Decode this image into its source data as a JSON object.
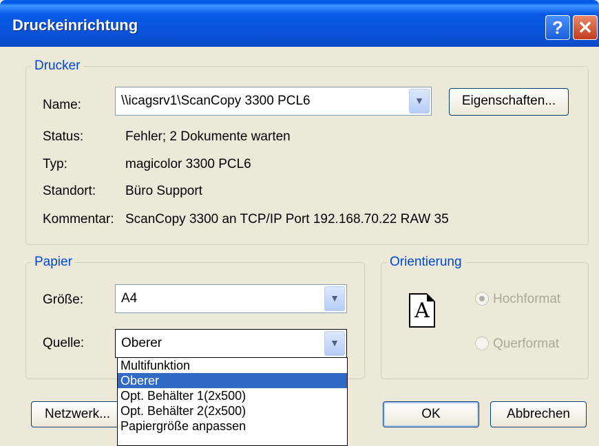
{
  "window": {
    "title": "Druckeinrichtung",
    "help_glyph": "?",
    "close_glyph": "✕"
  },
  "printer": {
    "group_label": "Drucker",
    "name_label": "Name:",
    "name_value": "\\\\icagsrv1\\ScanCopy 3300 PCL6",
    "properties_button": "Eigenschaften...",
    "status_label": "Status:",
    "status_value": "Fehler; 2 Dokumente warten",
    "type_label": "Typ:",
    "type_value": "magicolor 3300 PCL6",
    "location_label": "Standort:",
    "location_value": "Büro Support",
    "comment_label": "Kommentar:",
    "comment_value": "ScanCopy 3300 an TCP/IP Port 192.168.70.22 RAW 35"
  },
  "paper": {
    "group_label": "Papier",
    "size_label": "Größe:",
    "size_value": "A4",
    "source_label": "Quelle:",
    "source_value": "Oberer",
    "source_options": [
      "Multifunktion",
      "Oberer",
      "Opt. Behälter 1(2x500)",
      "Opt. Behälter 2(2x500)",
      "Papiergröße anpassen"
    ],
    "source_selected_index": 1
  },
  "orientation": {
    "group_label": "Orientierung",
    "portrait_label": "Hochformat",
    "landscape_label": "Querformat",
    "page_glyph": "A",
    "selected": "Hochformat"
  },
  "buttons": {
    "network": "Netzwerk...",
    "ok": "OK",
    "cancel": "Abbrechen"
  },
  "colors": {
    "titlebar": "#0a5ae8",
    "group_label": "#0046d5",
    "selection": "#316ac5",
    "background": "#ece9d8"
  }
}
